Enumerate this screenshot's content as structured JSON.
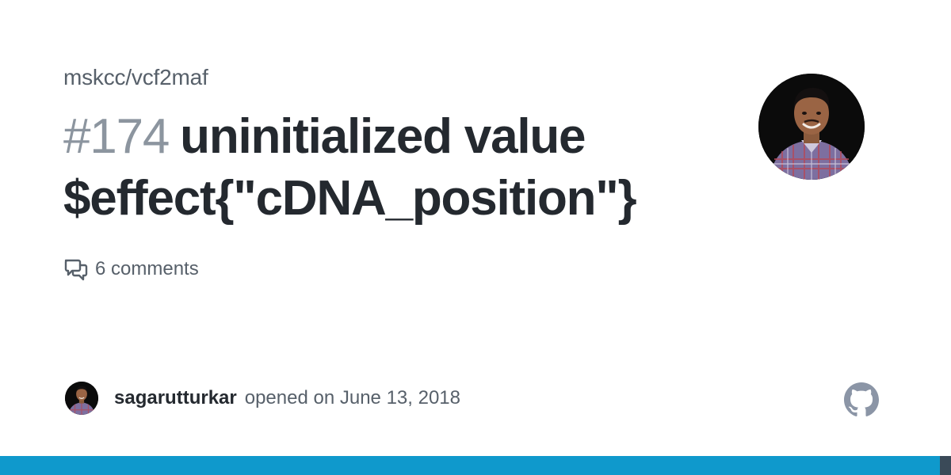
{
  "repo": "mskcc/vcf2maf",
  "issue": {
    "number": "#174",
    "title": "uninitialized value $effect{\"cDNA_position\"}"
  },
  "comments": {
    "label": "6 comments",
    "icon": "comment-discussion-icon"
  },
  "footer": {
    "username": "sagarutturkar",
    "meta": "opened on June 13, 2018"
  },
  "icons": {
    "brand": "github-mark-icon"
  },
  "colors": {
    "accent_bar": "#0f99cc",
    "accent_bar_end": "#3a4a58",
    "muted_text": "#57606a",
    "issue_number": "#8c959f"
  }
}
